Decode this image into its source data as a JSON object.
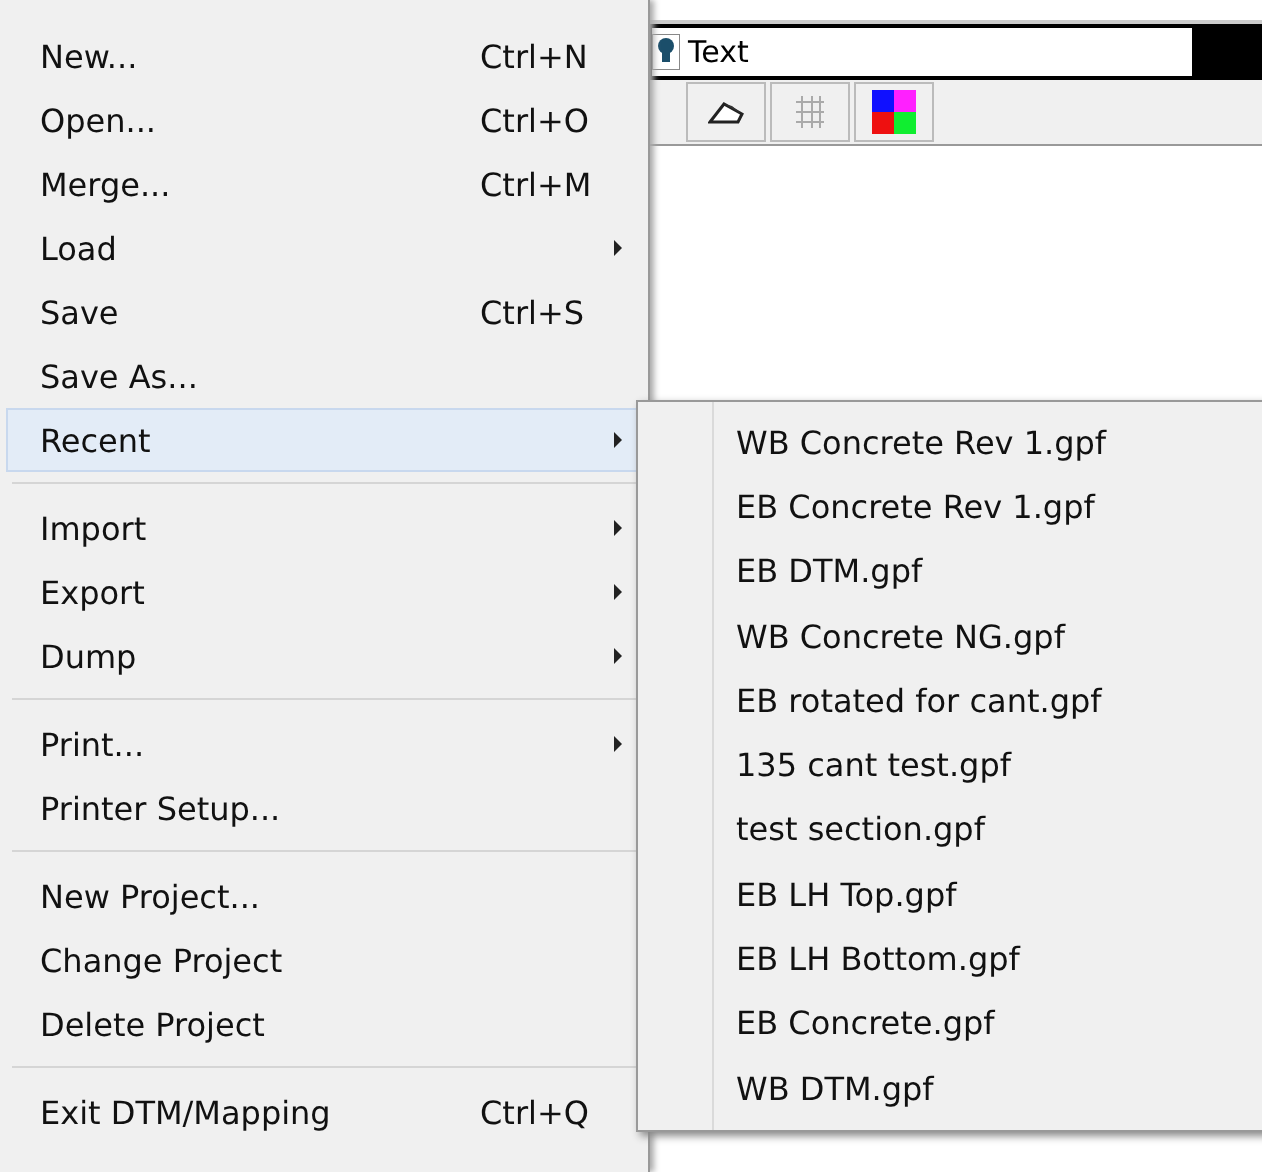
{
  "toolbar": {
    "text_field": {
      "value": "Text"
    }
  },
  "file_menu": {
    "groups": [
      [
        {
          "label": "New...",
          "shortcut": "Ctrl+N",
          "submenu": false,
          "selected": false
        },
        {
          "label": "Open...",
          "shortcut": "Ctrl+O",
          "submenu": false,
          "selected": false
        },
        {
          "label": "Merge...",
          "shortcut": "Ctrl+M",
          "submenu": false,
          "selected": false
        },
        {
          "label": "Load",
          "submenu": true,
          "selected": false
        },
        {
          "label": "Save",
          "shortcut": "Ctrl+S",
          "submenu": false,
          "selected": false
        },
        {
          "label": "Save As...",
          "submenu": false,
          "selected": false
        },
        {
          "label": "Recent",
          "submenu": true,
          "selected": true
        }
      ],
      [
        {
          "label": "Import",
          "submenu": true,
          "selected": false
        },
        {
          "label": "Export",
          "submenu": true,
          "selected": false
        },
        {
          "label": "Dump",
          "submenu": true,
          "selected": false
        }
      ],
      [
        {
          "label": "Print...",
          "submenu": true,
          "selected": false
        },
        {
          "label": "Printer Setup...",
          "submenu": false,
          "selected": false
        }
      ],
      [
        {
          "label": "New Project...",
          "submenu": false,
          "selected": false
        },
        {
          "label": "Change Project",
          "submenu": false,
          "selected": false
        },
        {
          "label": "Delete Project",
          "submenu": false,
          "selected": false
        }
      ],
      [
        {
          "label": "Exit DTM/Mapping",
          "shortcut": "Ctrl+Q",
          "submenu": false,
          "selected": false
        }
      ]
    ]
  },
  "recent_submenu": {
    "items": [
      "WB Concrete Rev 1.gpf",
      "EB Concrete Rev 1.gpf",
      "EB DTM.gpf",
      "WB Concrete NG.gpf",
      "EB rotated for cant.gpf",
      "135 cant test.gpf",
      "test section.gpf",
      "EB LH Top.gpf",
      "EB LH Bottom.gpf",
      "EB Concrete.gpf",
      "WB DTM.gpf"
    ]
  }
}
